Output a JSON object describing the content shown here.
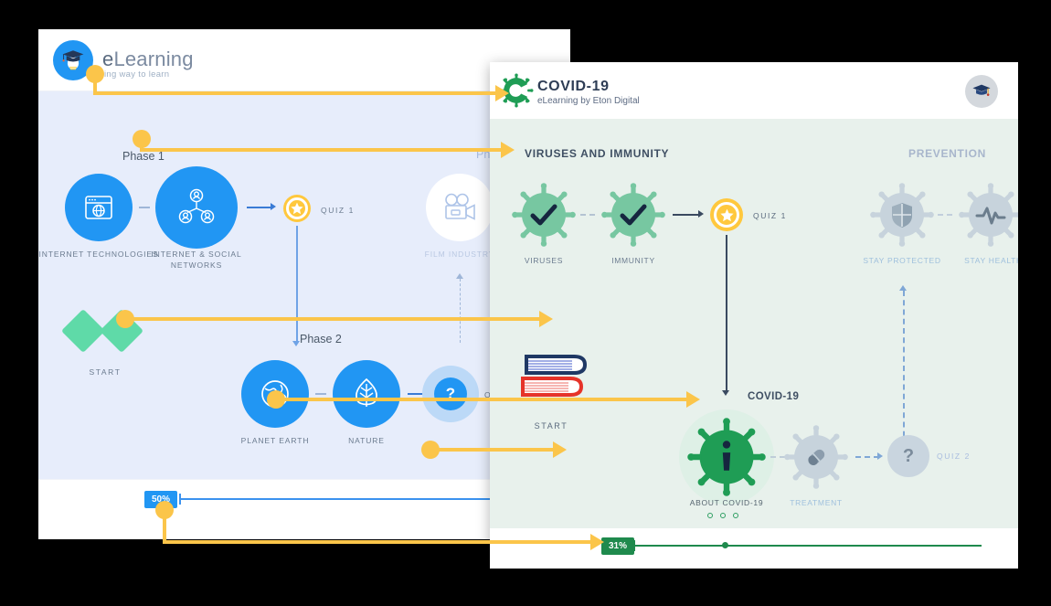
{
  "background_color": "#000000",
  "window1": {
    "name": "eLearning course map",
    "header": {
      "logo_icon": "graduation-cap-logo",
      "title_e": "e",
      "title_rest": "Learning",
      "tagline": "ing way to learn"
    },
    "body_bg": "#e7edfb",
    "phases": [
      {
        "label": "Phase 1"
      },
      {
        "label": "Phase 2"
      },
      {
        "label": "Ph"
      }
    ],
    "nodes": [
      {
        "id": "internet-technologies",
        "label": "INTERNET TECHNOLOGIES",
        "icon": "browser-globe-icon",
        "state": "active"
      },
      {
        "id": "internet-social-networks",
        "label": "INTERNET & SOCIAL\nNETWORKS",
        "icon": "social-network-icon",
        "state": "active"
      },
      {
        "id": "film-industry",
        "label": "FILM INDUSTRY",
        "icon": "film-camera-icon",
        "state": "locked"
      },
      {
        "id": "planet-earth",
        "label": "PLANET EARTH",
        "icon": "globe-icon",
        "state": "active"
      },
      {
        "id": "nature",
        "label": "NATURE",
        "icon": "leaf-icon",
        "state": "active"
      }
    ],
    "start": {
      "label": "START",
      "icon": "diamonds-icon"
    },
    "quizzes": [
      {
        "id": "quiz-1",
        "label": "QUIZ 1",
        "state": "available",
        "glyph": "star"
      },
      {
        "id": "quiz-2",
        "label": "QUI",
        "state": "locked",
        "glyph": "?"
      }
    ],
    "progress": {
      "value": "50%",
      "color": "#2196f3"
    }
  },
  "window2": {
    "name": "COVID-19 eLearning course map",
    "header": {
      "logo_icon": "covid-virus-c-logo",
      "title": "COVID-19",
      "subtitle": "eLearning by Eton Digital",
      "avatar_icon": "graduation-cap-avatar"
    },
    "body_bg": "#e8f1ec",
    "sections": [
      {
        "id": "viruses-and-immunity",
        "label": "VIRUSES AND IMMUNITY",
        "state": "active"
      },
      {
        "id": "prevention",
        "label": "PREVENTION",
        "state": "locked"
      },
      {
        "id": "covid-19",
        "label": "COVID-19",
        "state": "active"
      }
    ],
    "nodes": [
      {
        "id": "viruses",
        "label": "VIRUSES",
        "icon": "check-icon",
        "state": "completed"
      },
      {
        "id": "immunity",
        "label": "IMMUNITY",
        "icon": "check-icon",
        "state": "completed"
      },
      {
        "id": "stay-protected",
        "label": "STAY PROTECTED",
        "icon": "shield-icon",
        "state": "locked"
      },
      {
        "id": "stay-healthy",
        "label": "STAY HEALTH",
        "icon": "heartbeat-icon",
        "state": "locked"
      },
      {
        "id": "about-covid-19",
        "label": "ABOUT COVID-19",
        "icon": "info-person-icon",
        "state": "current"
      },
      {
        "id": "treatment",
        "label": "TREATMENT",
        "icon": "pill-icon",
        "state": "locked"
      }
    ],
    "start": {
      "label": "START",
      "icon": "books-icon"
    },
    "quizzes": [
      {
        "id": "quiz-1",
        "label": "QUIZ 1",
        "state": "available",
        "glyph": "star"
      },
      {
        "id": "quiz-2",
        "label": "QUIZ 2",
        "state": "locked",
        "glyph": "?"
      }
    ],
    "pagination_dots": 3,
    "progress": {
      "value": "31%",
      "color": "#1f8a4d"
    }
  },
  "annotations": {
    "color": "#fbc54a",
    "items": [
      {
        "id": "annotation-logo-to-covid-header",
        "from": "eLearning logo",
        "to": "COVID-19 header logo"
      },
      {
        "id": "annotation-phase1-to-section-title",
        "from": "Phase 1 label",
        "to": "VIRUSES AND IMMUNITY title"
      },
      {
        "id": "annotation-start-to-books",
        "from": "START diamonds",
        "to": "START books"
      },
      {
        "id": "annotation-planetearth-to-aboutcovid",
        "from": "PLANET EARTH node",
        "to": "ABOUT COVID-19 node"
      },
      {
        "id": "annotation-midmap-pointer",
        "from": "course map area",
        "to": "COVID course map area"
      },
      {
        "id": "annotation-progress-to-progress",
        "from": "50% progress bar",
        "to": "31% progress bar"
      }
    ]
  }
}
